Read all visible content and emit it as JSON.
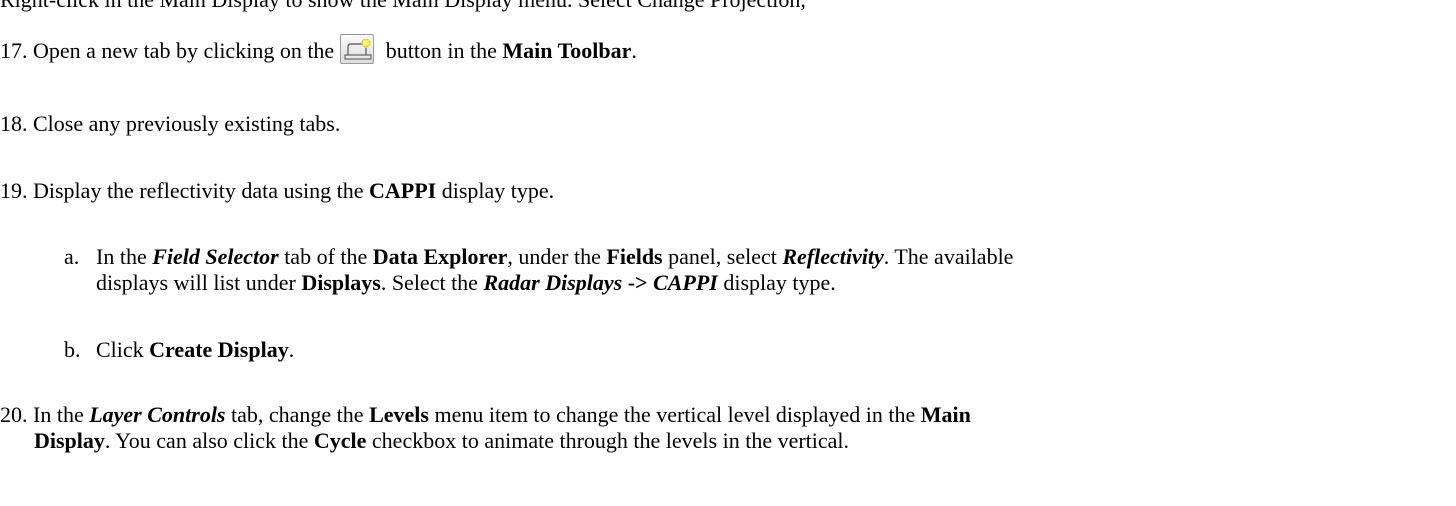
{
  "doc": {
    "cut_line": "Right-click in the Main Display to show the Main Display menu. Select Change Projection,",
    "step17": {
      "num": "17. ",
      "pre": "Open a new tab by clicking on the",
      "post": " button in the ",
      "bold": "Main Toolbar",
      "end": ".",
      "icon": "new-tab-icon"
    },
    "step18": {
      "num": "18. ",
      "text": "Close any previously existing tabs."
    },
    "step19": {
      "num": "19. ",
      "pre": "Display the reflectivity data using the ",
      "bold": "CAPPI",
      "post": " display type."
    },
    "step19a": {
      "marker": "a.",
      "t1": "In the ",
      "bi1": "Field Selector",
      "t2": " tab of the ",
      "b1": "Data Explorer",
      "t3": ", under the ",
      "b2": "Fields",
      "t4": " panel, select ",
      "bi2": "Reflectivity",
      "t5": ". The available",
      "t6": "displays will list under ",
      "b3": "Displays",
      "t7": ". Select the ",
      "bi3": "Radar Displays",
      "b4": " -> ",
      "bi4": "CAPPI",
      "t8": " display type."
    },
    "step19b": {
      "marker": "b.",
      "t1": "Click ",
      "b1": "Create Display",
      "t2": "."
    },
    "step20": {
      "num": "20. ",
      "t1": "In the ",
      "bi1": "Layer Controls",
      "t2": " tab, change the ",
      "b1": "Levels",
      "t3": " menu item to change the vertical level displayed in the ",
      "b2": "Main",
      "b3": "Display",
      "t4": ". You can also click the ",
      "b4": "Cycle",
      "t5": " checkbox to animate through the levels in the vertical."
    }
  }
}
